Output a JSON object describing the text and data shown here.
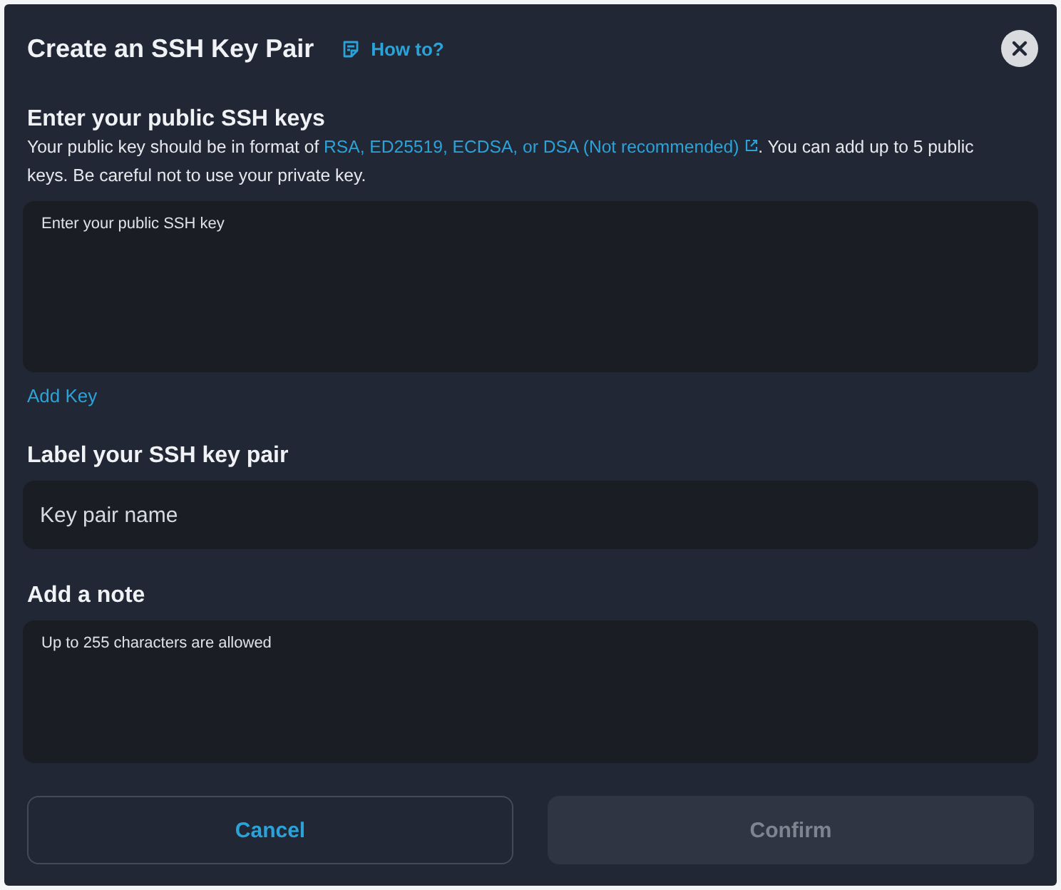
{
  "dialog": {
    "title": "Create an SSH Key Pair",
    "help_link": "How to?"
  },
  "sections": [
    {
      "kind": "keys",
      "heading": "Enter your public SSH keys",
      "description": {
        "before": "Your public key should be in format of ",
        "link": "RSA, ED25519, ECDSA, or DSA (Not recommended)",
        "after": ". You can add up to 5 public keys. Be careful not to use your private key."
      },
      "field": {
        "placeholder": "Enter your public SSH key",
        "multiline": true
      },
      "action": "Add Key"
    },
    {
      "kind": "label",
      "heading": "Label your SSH key pair",
      "field": {
        "placeholder": "Key pair name",
        "multiline": false
      }
    },
    {
      "kind": "note",
      "heading": "Add a note",
      "field": {
        "placeholder": "Up to 255 characters are allowed",
        "multiline": true
      }
    }
  ],
  "buttons": [
    {
      "label": "Cancel",
      "kind": "secondary",
      "disabled": false
    },
    {
      "label": "Confirm",
      "kind": "primary",
      "disabled": true
    }
  ]
}
